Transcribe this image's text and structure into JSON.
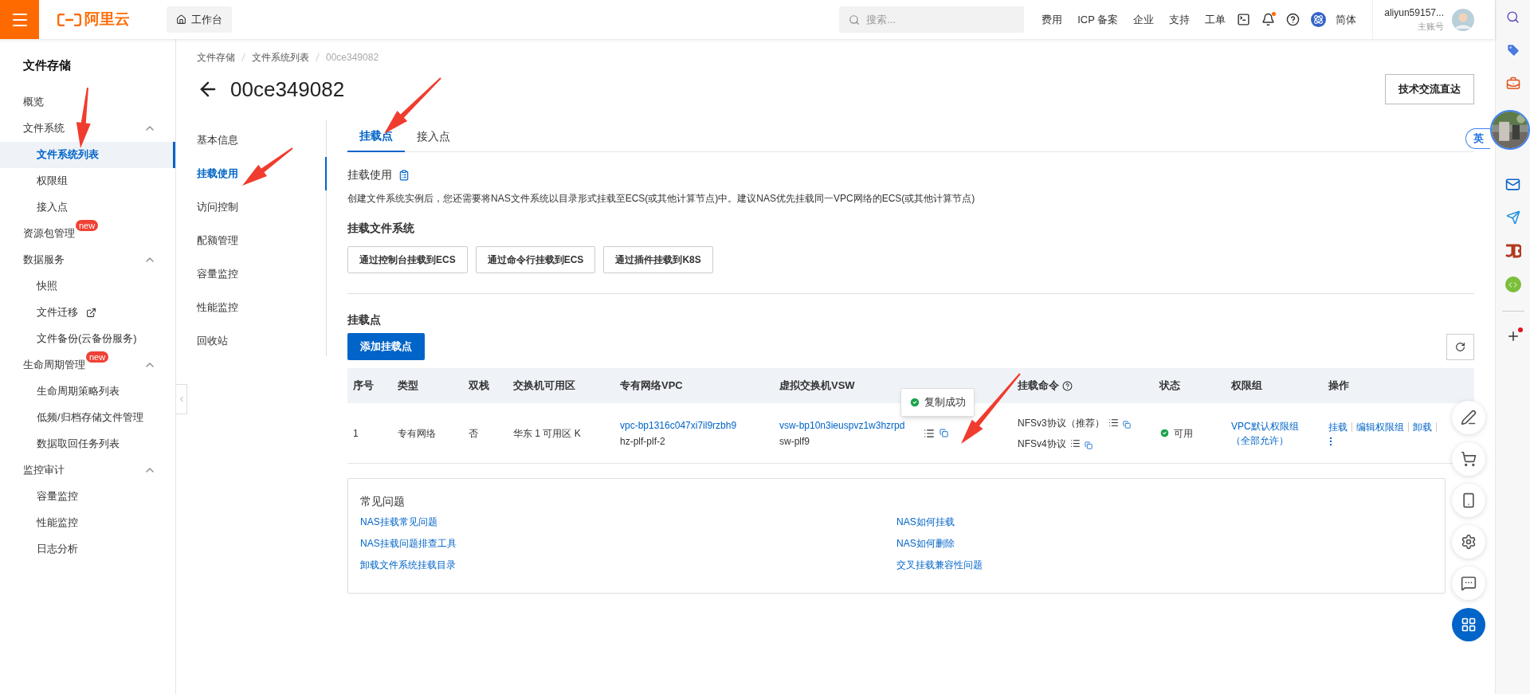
{
  "top_bar": {
    "logo_text": "阿里云",
    "workbench": "工作台",
    "search": {
      "placeholder": "搜索..."
    },
    "links": [
      "费用",
      "ICP 备案",
      "企业",
      "支持",
      "工单"
    ],
    "notifications": {
      "unread": true
    },
    "language": "简体",
    "account": {
      "name": "aliyun59157...",
      "role": "主账号"
    }
  },
  "sidebar": {
    "title": "文件存储",
    "items": [
      {
        "label": "概览",
        "kind": "link",
        "selected": false
      },
      {
        "label": "文件系统",
        "kind": "group",
        "expanded": true,
        "selected": false,
        "children": [
          {
            "label": "文件系统列表",
            "selected": true,
            "external": false
          },
          {
            "label": "权限组",
            "selected": false,
            "external": false
          },
          {
            "label": "接入点",
            "selected": false,
            "external": false
          }
        ]
      },
      {
        "label": "资源包管理",
        "kind": "link",
        "selected": false,
        "badge": "new"
      },
      {
        "label": "数据服务",
        "kind": "group",
        "expanded": true,
        "selected": false,
        "children": [
          {
            "label": "快照",
            "selected": false,
            "external": false
          },
          {
            "label": "文件迁移",
            "selected": false,
            "external": true
          },
          {
            "label": "文件备份(云备份服务)",
            "selected": false,
            "external": false
          }
        ]
      },
      {
        "label": "生命周期管理",
        "kind": "group",
        "expanded": true,
        "selected": false,
        "badge": "new",
        "children": [
          {
            "label": "生命周期策略列表",
            "selected": false,
            "external": false
          },
          {
            "label": "低频/归档存储文件管理",
            "selected": false,
            "external": false
          },
          {
            "label": "数据取回任务列表",
            "selected": false,
            "external": false
          }
        ]
      },
      {
        "label": "监控审计",
        "kind": "group",
        "expanded": true,
        "selected": false,
        "children": [
          {
            "label": "容量监控",
            "selected": false,
            "external": false
          },
          {
            "label": "性能监控",
            "selected": false,
            "external": false
          },
          {
            "label": "日志分析",
            "selected": false,
            "external": false
          }
        ]
      }
    ]
  },
  "breadcrumb": [
    "文件存储",
    "文件系统列表",
    "00ce349082"
  ],
  "page_title": "00ce349082",
  "header_button": "技术交流直达",
  "sub_nav": [
    {
      "label": "基本信息",
      "selected": false
    },
    {
      "label": "挂载使用",
      "selected": true
    },
    {
      "label": "访问控制",
      "selected": false
    },
    {
      "label": "配额管理",
      "selected": false
    },
    {
      "label": "容量监控",
      "selected": false
    },
    {
      "label": "性能监控",
      "selected": false
    },
    {
      "label": "回收站",
      "selected": false
    }
  ],
  "tabs": [
    {
      "label": "挂载点",
      "selected": true
    },
    {
      "label": "接入点",
      "selected": false
    }
  ],
  "usage": {
    "title": "挂载使用",
    "description": "创建文件系统实例后，您还需要将NAS文件系统以目录形式挂载至ECS(或其他计算节点)中。建议NAS优先挂载同一VPC网络的ECS(或其他计算节点)",
    "subheading": "挂载文件系统",
    "buttons": [
      "通过控制台挂载到ECS",
      "通过命令行挂载到ECS",
      "通过插件挂载到K8S"
    ]
  },
  "mount_points": {
    "title": "挂载点",
    "add_button": "添加挂载点",
    "columns": [
      "序号",
      "类型",
      "双栈",
      "交换机可用区",
      "专有网络VPC",
      "虚拟交换机VSW",
      "",
      "挂载命令",
      "状态",
      "权限组",
      "操作"
    ],
    "rows": [
      {
        "index": "1",
        "type": "专有网络",
        "dual_stack": "否",
        "zone": "华东 1 可用区 K",
        "vpc_id": "vpc-bp1316c047xi7il9rzbh9",
        "vpc_name": "hz-plf-plf-2",
        "vsw_id": "vsw-bp10n3ieuspvz1w3hzrpd",
        "vsw_name": "sw-plf9",
        "tooltip": "复制成功",
        "commands": [
          "NFSv3协议（推荐）",
          "NFSv4协议"
        ],
        "status": "可用",
        "permission_group": [
          "VPC默认权限组",
          "（全部允许）"
        ],
        "actions": [
          "挂载",
          "编辑权限组",
          "卸载"
        ]
      }
    ]
  },
  "faq": {
    "title": "常见问题",
    "links": [
      "NAS挂载常见问题",
      "NAS如何挂载",
      "NAS挂载问题排查工具",
      "NAS如何删除",
      "卸载文件系统挂载目录",
      "交叉挂载兼容性问题"
    ]
  },
  "language_switch": "英"
}
